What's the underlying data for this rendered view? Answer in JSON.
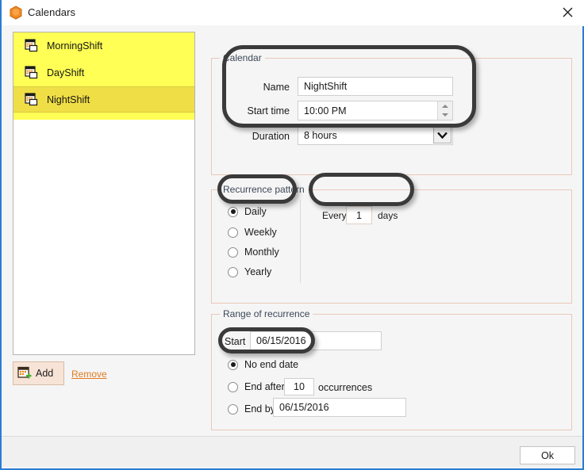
{
  "window": {
    "title": "Calendars",
    "icon": "app-hexagon-icon",
    "close_icon": "close-icon",
    "accent_border": "#2b7cd3"
  },
  "list": {
    "items": [
      {
        "label": "MorningShift",
        "icon": "calendar-icon",
        "selected": false
      },
      {
        "label": "DayShift",
        "icon": "calendar-icon",
        "selected": false
      },
      {
        "label": "NightShift",
        "icon": "calendar-icon",
        "selected": true
      }
    ],
    "highlight_color": "#ffff55",
    "selected_color": "#f0de46"
  },
  "actions": {
    "add_label": "Add",
    "add_icon": "calendar-add-icon",
    "remove_label": "Remove",
    "remove_color": "#e07b20"
  },
  "calendar_group": {
    "title": "Calendar",
    "name_label": "Name",
    "name_value": "NightShift",
    "start_time_label": "Start time",
    "start_time_value": "10:00 PM",
    "duration_label": "Duration",
    "duration_value": "8 hours"
  },
  "recurrence_pattern": {
    "title": "Recurrence pattern",
    "options": [
      {
        "label": "Daily",
        "checked": true
      },
      {
        "label": "Weekly",
        "checked": false
      },
      {
        "label": "Monthly",
        "checked": false
      },
      {
        "label": "Yearly",
        "checked": false
      }
    ],
    "every_label": "Every",
    "every_value": "1",
    "days_label": "days"
  },
  "range_of_recurrence": {
    "title": "Range of recurrence",
    "start_label": "Start",
    "start_value": "06/15/2016",
    "no_end_date_label": "No end date",
    "no_end_date_checked": true,
    "end_after_label": "End after:",
    "end_after_value": "10",
    "occurrences_label": "occurrences",
    "end_after_checked": false,
    "end_by_label": "End by:",
    "end_by_value": "06/15/2016",
    "end_by_checked": false
  },
  "footer": {
    "ok_label": "Ok"
  }
}
